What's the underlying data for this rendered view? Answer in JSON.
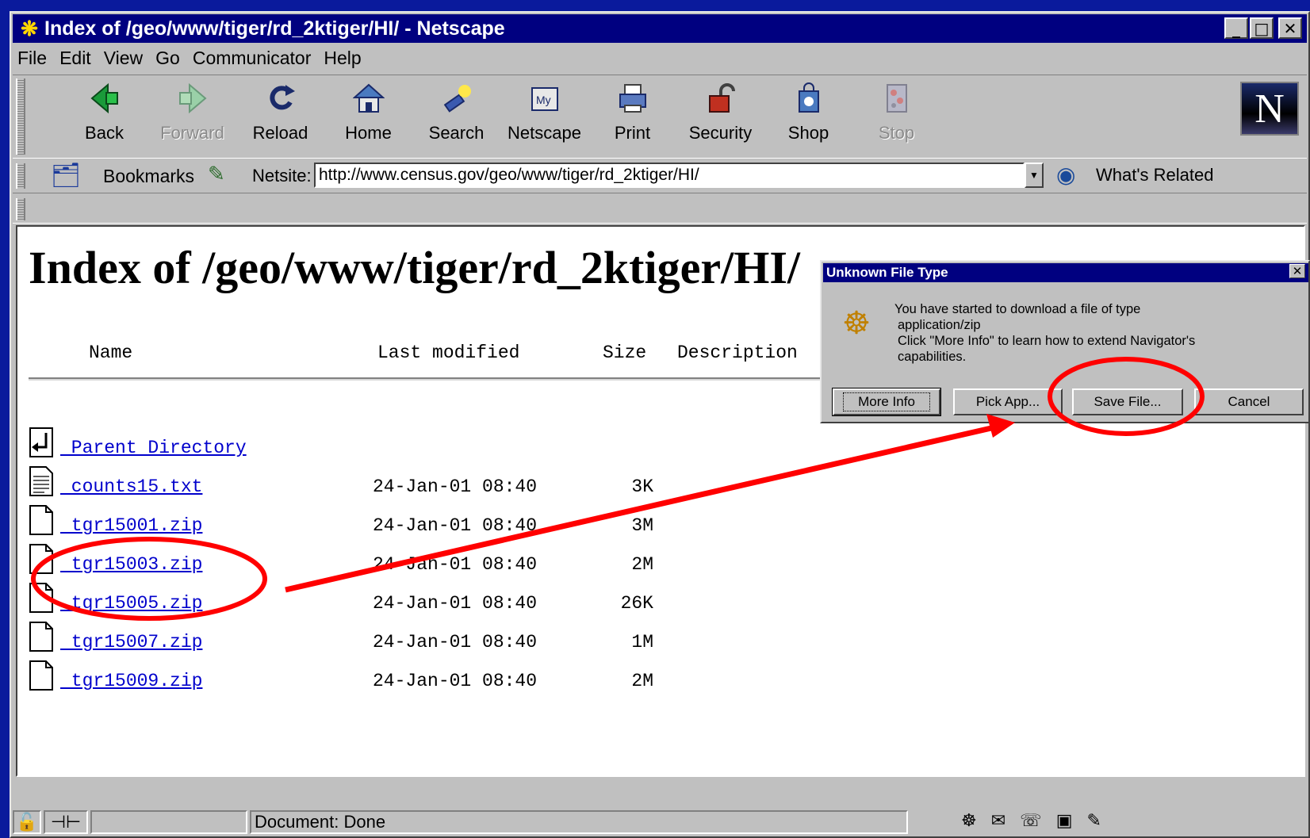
{
  "window": {
    "title": "Index of /geo/www/tiger/rd_2ktiger/HI/ - Netscape",
    "app_icon": "netscape-wheel-icon",
    "buttons": {
      "minimize": "_",
      "maximize": "□",
      "close": "✕"
    }
  },
  "menu": [
    "File",
    "Edit",
    "View",
    "Go",
    "Communicator",
    "Help"
  ],
  "toolbar": {
    "buttons": [
      {
        "label": "Back",
        "icon": "back-arrow-icon",
        "enabled": true
      },
      {
        "label": "Forward",
        "icon": "forward-arrow-icon",
        "enabled": false
      },
      {
        "label": "Reload",
        "icon": "reload-icon",
        "enabled": true
      },
      {
        "label": "Home",
        "icon": "home-icon",
        "enabled": true
      },
      {
        "label": "Search",
        "icon": "search-flashlight-icon",
        "enabled": true
      },
      {
        "label": "Netscape",
        "icon": "my-netscape-icon",
        "enabled": true
      },
      {
        "label": "Print",
        "icon": "printer-icon",
        "enabled": true
      },
      {
        "label": "Security",
        "icon": "padlock-icon",
        "enabled": true
      },
      {
        "label": "Shop",
        "icon": "shopping-bag-icon",
        "enabled": true
      },
      {
        "label": "Stop",
        "icon": "stop-icon",
        "enabled": false
      }
    ],
    "logo": "N"
  },
  "location": {
    "bookmarks_label": "Bookmarks",
    "netsite_label": "Netsite:",
    "url": "http://www.census.gov/geo/www/tiger/rd_2ktiger/HI/",
    "whats_related_label": "What's Related"
  },
  "page": {
    "heading": "Index of /geo/www/tiger/rd_2ktiger/HI/",
    "columns": {
      "name": "Name",
      "last_modified": "Last modified",
      "size": "Size",
      "description": "Description"
    },
    "rows": [
      {
        "icon": "back-folder-icon",
        "name": " Parent Directory",
        "date": "",
        "size": ""
      },
      {
        "icon": "text-file-icon",
        "name": " counts15.txt",
        "date": "24-Jan-01 08:40",
        "size": "3K"
      },
      {
        "icon": "blank-file-icon",
        "name": " tgr15001.zip",
        "date": "24-Jan-01 08:40",
        "size": "3M"
      },
      {
        "icon": "blank-file-icon",
        "name": " tgr15003.zip",
        "date": "24-Jan-01 08:40",
        "size": "2M"
      },
      {
        "icon": "blank-file-icon",
        "name": " tgr15005.zip",
        "date": "24-Jan-01 08:40",
        "size": "26K"
      },
      {
        "icon": "blank-file-icon",
        "name": " tgr15007.zip",
        "date": "24-Jan-01 08:40",
        "size": "1M"
      },
      {
        "icon": "blank-file-icon",
        "name": " tgr15009.zip",
        "date": "24-Jan-01 08:40",
        "size": "2M"
      }
    ]
  },
  "status": {
    "text": "Document: Done"
  },
  "dialog": {
    "title": "Unknown File Type",
    "close": "✕",
    "line1": "You have started to download a file of type",
    "line2": "application/zip",
    "line3": "Click \"More Info\" to learn how to extend Navigator's",
    "line4": "capabilities.",
    "buttons": {
      "more_info": "More Info",
      "pick_app": "Pick App...",
      "save_file": "Save File...",
      "cancel": "Cancel"
    }
  },
  "annotation": {
    "color": "#ff0000"
  }
}
